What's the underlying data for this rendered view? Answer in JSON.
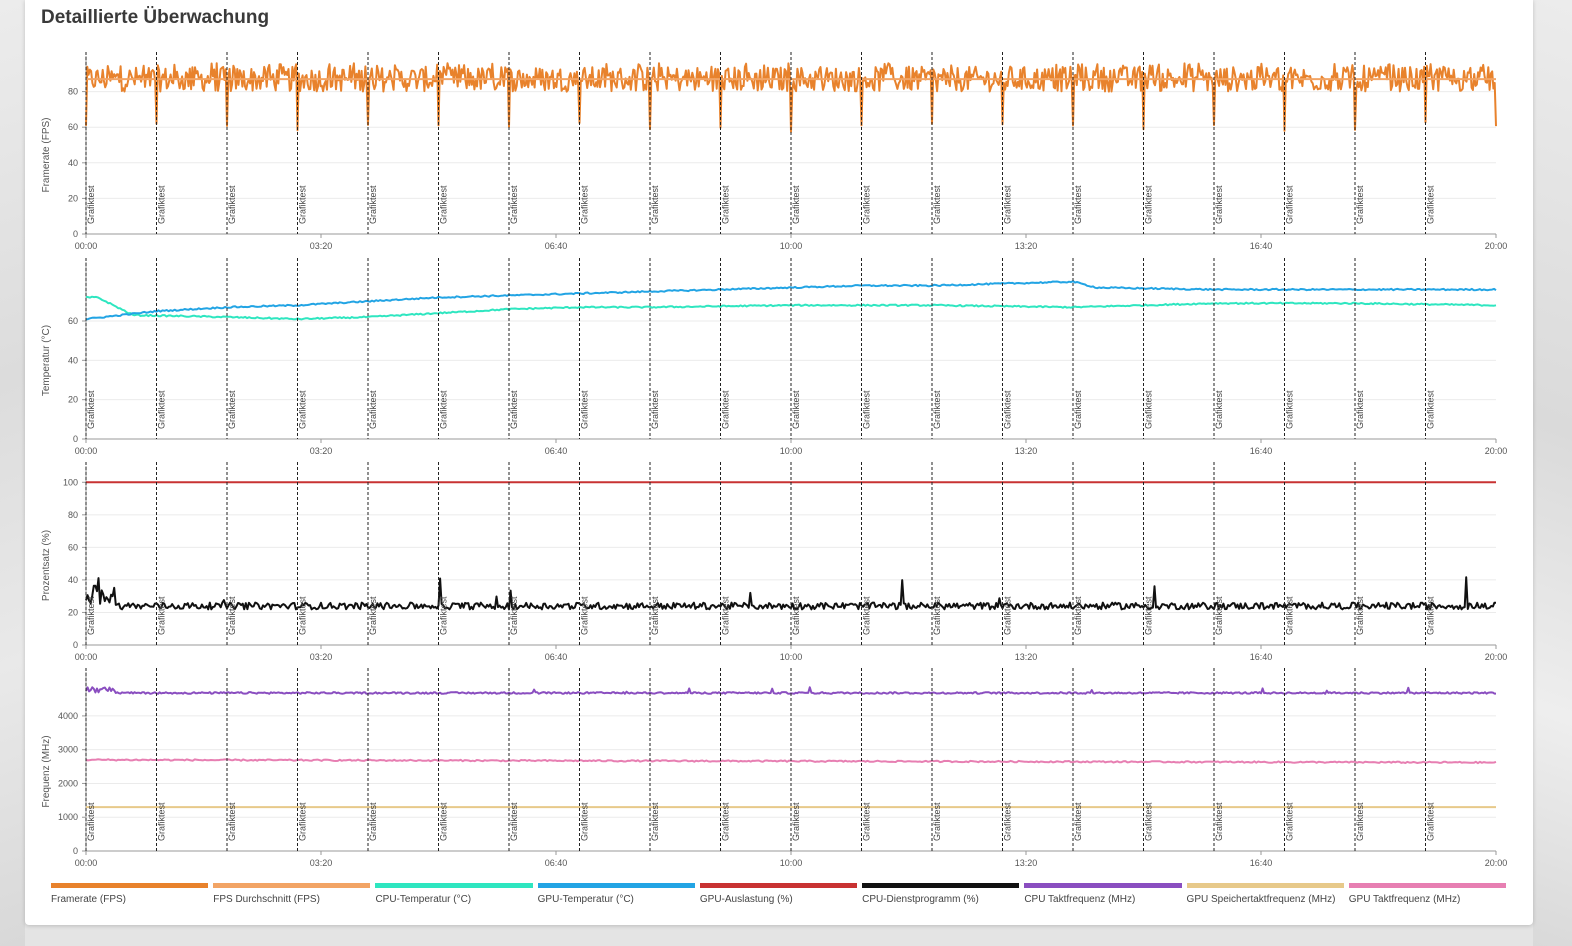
{
  "page": {
    "title": "Detaillierte Überwachung"
  },
  "legend": [
    {
      "label": "Framerate (FPS)",
      "color": "#e8822c"
    },
    {
      "label": "FPS Durchschnitt (FPS)",
      "color": "#f2a465"
    },
    {
      "label": "CPU-Temperatur (°C)",
      "color": "#2ee6c0"
    },
    {
      "label": "GPU-Temperatur (°C)",
      "color": "#22a4e4"
    },
    {
      "label": "GPU-Auslastung (%)",
      "color": "#c83232"
    },
    {
      "label": "CPU-Dienstprogramm (%)",
      "color": "#111111"
    },
    {
      "label": "CPU Taktfrequenz (MHz)",
      "color": "#8a4ec0"
    },
    {
      "label": "GPU Speichertaktfrequenz (MHz)",
      "color": "#e7c98a"
    },
    {
      "label": "GPU Taktfrequenz (MHz)",
      "color": "#e77fb2"
    }
  ],
  "chart_data": [
    {
      "type": "line",
      "ylabel": "Framerate (FPS)",
      "xlim": [
        "00:00",
        "20:00"
      ],
      "ylim": [
        0,
        100
      ],
      "yticks": [
        "0",
        "20",
        "40",
        "60",
        "80"
      ],
      "xticks": [
        "00:00",
        "03:20",
        "06:40",
        "10:00",
        "13:20",
        "16:40",
        "20:00"
      ],
      "markers": {
        "label": "Grafiktest",
        "x": [
          "00:00",
          "01:00",
          "02:00",
          "03:00",
          "04:00",
          "05:00",
          "06:00",
          "07:00",
          "08:00",
          "09:00",
          "10:00",
          "11:00",
          "12:00",
          "13:00",
          "14:00",
          "15:00",
          "16:00",
          "17:00",
          "18:00",
          "19:00"
        ]
      },
      "grid": true,
      "series": [
        {
          "name": "Framerate (FPS)",
          "color": "#e8822c",
          "pattern": "noisy_periodic",
          "min": 57,
          "max": 96,
          "typical": 87
        },
        {
          "name": "FPS Durchschnitt (FPS)",
          "color": "#f2a465",
          "pattern": "flat",
          "value": 87
        }
      ]
    },
    {
      "type": "line",
      "ylabel": "Temperatur (°C)",
      "xlim": [
        "00:00",
        "20:00"
      ],
      "ylim": [
        0,
        90
      ],
      "yticks": [
        "0",
        "20",
        "40",
        "60"
      ],
      "xticks": [
        "00:00",
        "03:20",
        "06:40",
        "10:00",
        "13:20",
        "16:40",
        "20:00"
      ],
      "markers": {
        "label": "Grafiktest",
        "x": [
          "00:00",
          "01:00",
          "02:00",
          "03:00",
          "04:00",
          "05:00",
          "06:00",
          "07:00",
          "08:00",
          "09:00",
          "10:00",
          "11:00",
          "12:00",
          "13:00",
          "14:00",
          "15:00",
          "16:00",
          "17:00",
          "18:00",
          "19:00"
        ]
      },
      "grid": true,
      "series": [
        {
          "name": "CPU-Temperatur (°C)",
          "color": "#2ee6c0",
          "x": [
            "00:00",
            "00:10",
            "00:40",
            "02:00",
            "03:00",
            "04:00",
            "05:00",
            "06:00",
            "07:00",
            "08:00",
            "10:00",
            "12:00",
            "14:00",
            "16:00",
            "18:00",
            "20:00"
          ],
          "values": [
            72,
            72,
            63,
            62,
            61,
            62,
            64,
            66,
            67,
            67,
            68,
            68,
            67,
            69,
            69,
            68
          ]
        },
        {
          "name": "GPU-Temperatur (°C)",
          "color": "#22a4e4",
          "x": [
            "00:00",
            "01:00",
            "02:00",
            "03:00",
            "04:00",
            "05:00",
            "06:00",
            "07:00",
            "08:00",
            "09:00",
            "10:00",
            "11:00",
            "12:00",
            "13:00",
            "14:00",
            "14:20",
            "16:00",
            "18:00",
            "20:00"
          ],
          "values": [
            61,
            65,
            67,
            68,
            70,
            72,
            73,
            74,
            75,
            76,
            77,
            78,
            78,
            79,
            80,
            77,
            76,
            76,
            76
          ]
        }
      ]
    },
    {
      "type": "line",
      "ylabel": "Prozentsatz (%)",
      "xlim": [
        "00:00",
        "20:00"
      ],
      "ylim": [
        0,
        110
      ],
      "yticks": [
        "0",
        "20",
        "40",
        "60",
        "80",
        "100"
      ],
      "xticks": [
        "00:00",
        "03:20",
        "06:40",
        "10:00",
        "13:20",
        "16:40",
        "20:00"
      ],
      "markers": {
        "label": "Grafiktest",
        "x": [
          "00:00",
          "01:00",
          "02:00",
          "03:00",
          "04:00",
          "05:00",
          "06:00",
          "07:00",
          "08:00",
          "09:00",
          "10:00",
          "11:00",
          "12:00",
          "13:00",
          "14:00",
          "15:00",
          "16:00",
          "17:00",
          "18:00",
          "19:00"
        ]
      },
      "grid": true,
      "series": [
        {
          "name": "GPU-Auslastung (%)",
          "color": "#c83232",
          "pattern": "flat",
          "value": 100
        },
        {
          "name": "CPU-Dienstprogramm (%)",
          "color": "#111111",
          "pattern": "noisy",
          "min": 19,
          "max": 42,
          "typical": 24
        }
      ]
    },
    {
      "type": "line",
      "ylabel": "Frequenz (MHz)",
      "xlim": [
        "00:00",
        "20:00"
      ],
      "ylim": [
        0,
        5300
      ],
      "yticks": [
        "0",
        "1000",
        "2000",
        "3000",
        "4000"
      ],
      "xticks": [
        "00:00",
        "03:20",
        "06:40",
        "10:00",
        "13:20",
        "16:40",
        "20:00"
      ],
      "markers": {
        "label": "Grafiktest",
        "x": [
          "00:00",
          "01:00",
          "02:00",
          "03:00",
          "04:00",
          "05:00",
          "06:00",
          "07:00",
          "08:00",
          "09:00",
          "10:00",
          "11:00",
          "12:00",
          "13:00",
          "14:00",
          "15:00",
          "16:00",
          "17:00",
          "18:00",
          "19:00"
        ]
      },
      "grid": true,
      "series": [
        {
          "name": "CPU Taktfrequenz (MHz)",
          "color": "#8a4ec0",
          "pattern": "noisy",
          "min": 4570,
          "max": 4850,
          "typical": 4680
        },
        {
          "name": "GPU Taktfrequenz (MHz)",
          "color": "#e77fb2",
          "x": [
            "00:00",
            "20:00"
          ],
          "values": [
            2700,
            2620
          ]
        },
        {
          "name": "GPU Speichertaktfrequenz (MHz)",
          "color": "#e7c98a",
          "pattern": "flat",
          "value": 1300
        }
      ]
    }
  ]
}
